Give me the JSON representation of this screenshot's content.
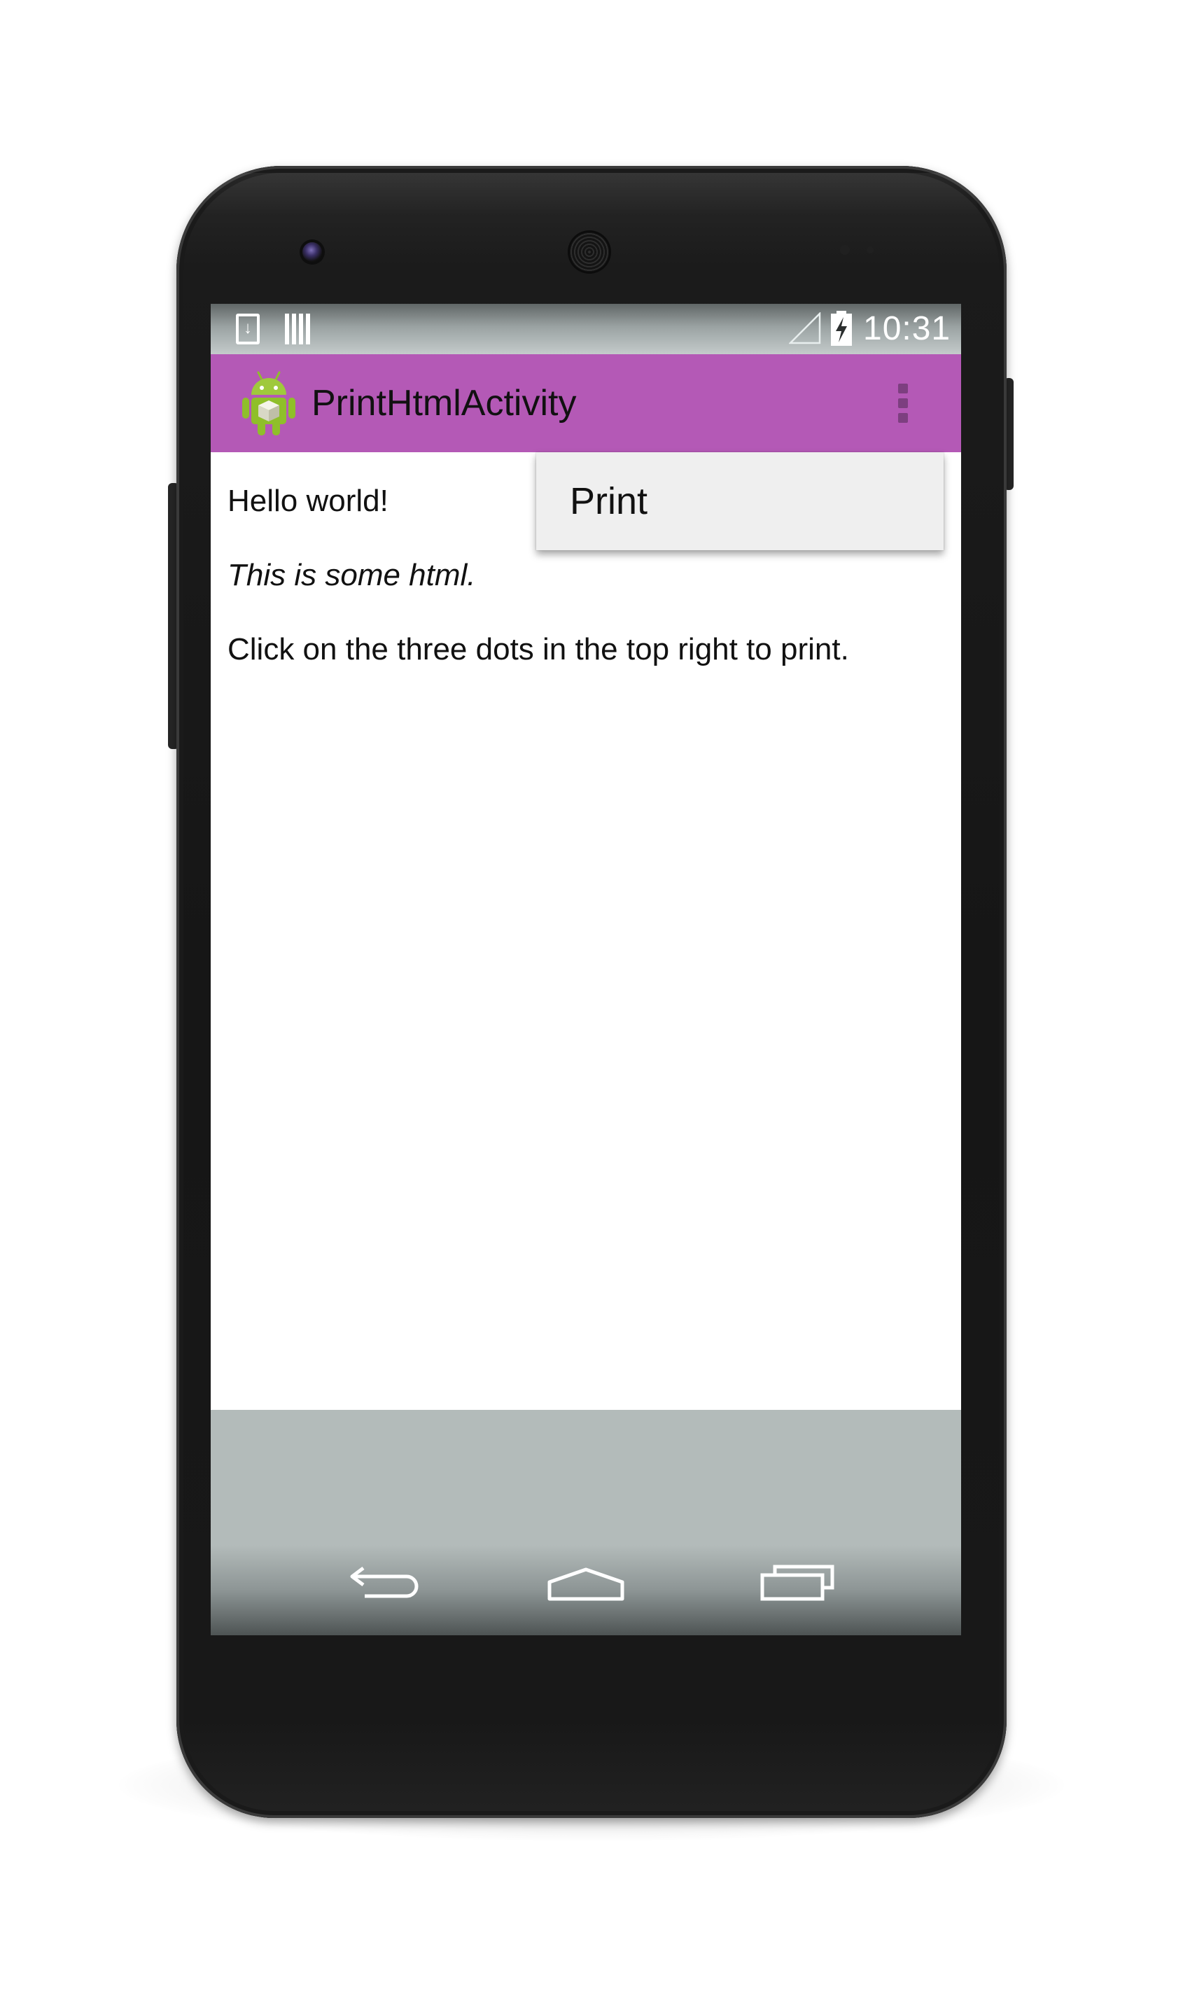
{
  "status_bar": {
    "time": "10:31",
    "icons": [
      "download-notification-icon",
      "barcode-notification-icon",
      "signal-icon",
      "battery-charging-icon"
    ]
  },
  "action_bar": {
    "app_icon": "android-robot-icon",
    "title": "PrintHtmlActivity",
    "overflow_icon": "overflow-menu-icon",
    "background_color": "#b459b6"
  },
  "content": {
    "line1": "Hello world!",
    "line2": "This is some html.",
    "line3": "Click on the three dots in the top right to print."
  },
  "overflow_menu": {
    "items": [
      {
        "label": "Print"
      }
    ]
  },
  "nav_bar": {
    "buttons": [
      "back-icon",
      "home-icon",
      "recent-apps-icon"
    ]
  }
}
